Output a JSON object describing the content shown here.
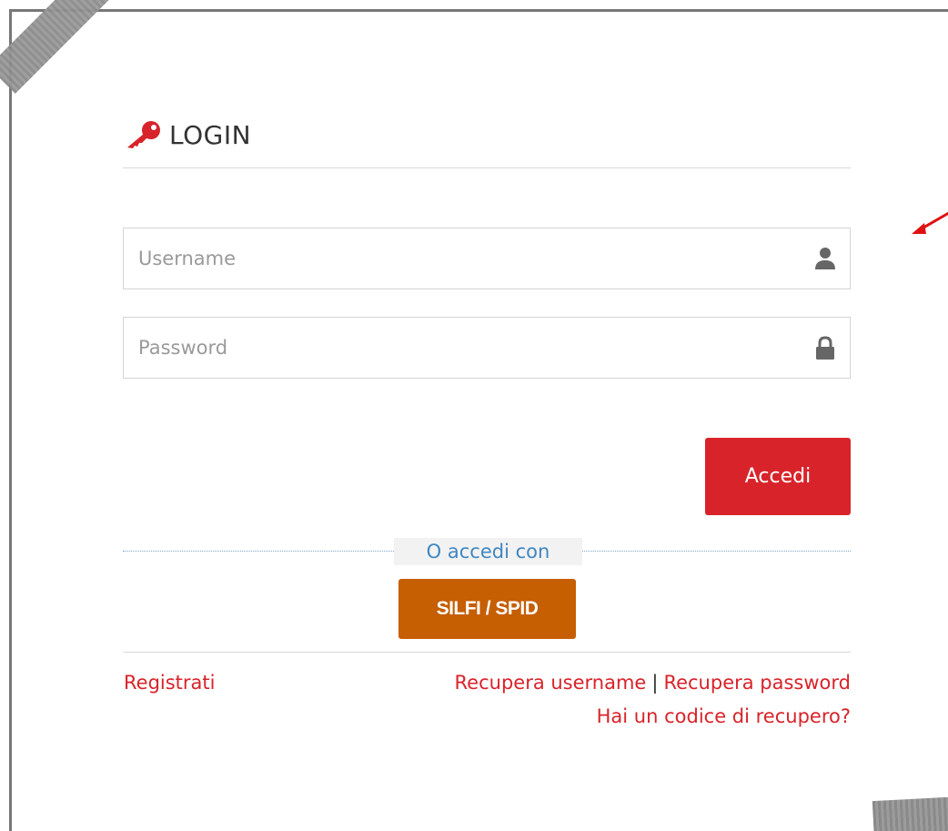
{
  "login": {
    "title": "LOGIN"
  },
  "form": {
    "username_placeholder": "Username",
    "password_placeholder": "Password",
    "submit_label": "Accedi"
  },
  "alt_login": {
    "divider_text": "O accedi con",
    "spid_label": "SILFI / SPID"
  },
  "links": {
    "register": "Registrati",
    "recover_username": "Recupera username",
    "separator": "|",
    "recover_password": "Recupera password",
    "recovery_code": "Hai un codice di recupero?"
  },
  "icons": {
    "header": "key-icon",
    "username": "user-icon",
    "password": "lock-icon",
    "annotation": "red-arrow-icon"
  },
  "colors": {
    "accent_red": "#d8232a",
    "spid_orange": "#c65e02",
    "divider_blue": "#3f87c2"
  }
}
